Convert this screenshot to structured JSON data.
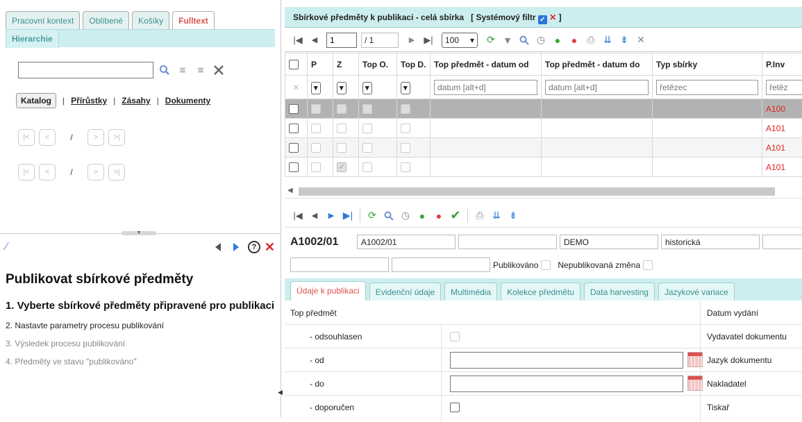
{
  "left": {
    "tabs": [
      "Pracovní kontext",
      "Oblíbené",
      "Košíky",
      "Fulltext"
    ],
    "tab_hierarchy": "Hierarchie",
    "search": {
      "value": ""
    },
    "links": {
      "katalog": "Katalog",
      "prirustky": "Přírůstky",
      "zasahy": "Zásahy",
      "dokumenty": "Dokumenty",
      "sep": "|"
    },
    "pager": {
      "first": "|<",
      "prev": "<",
      "slash": "/",
      "next": ">",
      "last": ">|"
    },
    "wizard": {
      "title": "Publikovat sbírkové předměty",
      "step1": "1. Vyberte sbírkové předměty připravené pro publikaci",
      "step2": "2. Nastavte parametry procesu publikování",
      "step3": "3. Výsledek procesu publikování",
      "step4": "4. Předměty ve stavu \"publikováno\"",
      "help": "?",
      "close": "✕"
    }
  },
  "right": {
    "title": "Sbírkové předměty k publikaci - celá sbírka",
    "filter_prefix": "[ Systémový filtr",
    "filter_suffix": "]",
    "pager": {
      "page": "1",
      "total": "/ 1",
      "size": "100"
    },
    "grid": {
      "columns": [
        "P",
        "Z",
        "Top O.",
        "Top D.",
        "Top předmět - datum od",
        "Top předmět - datum do",
        "Typ sbírky",
        "P.Inv"
      ],
      "filters": {
        "date_from": "datum [alt+d]",
        "date_to": "datum [alt+d]",
        "typ": "řetězec",
        "pinv": "řetěz"
      },
      "rows": [
        {
          "pinv": "A100"
        },
        {
          "pinv": "A101"
        },
        {
          "pinv": "A101"
        },
        {
          "pinv": "A101"
        }
      ]
    },
    "detail": {
      "record_id": "A1002/01",
      "field1": "A1002/01",
      "field2": "",
      "field3": "DEMO",
      "field4": "historická",
      "publikovano": "Publikováno",
      "nepublikovana": "Nepublikovaná změna"
    },
    "detail_tabs": [
      "Údaje k publikaci",
      "Evidenční údaje",
      "Multimédia",
      "Kolekce předmětu",
      "Data harvesting",
      "Jazykové variace"
    ],
    "form": {
      "top_predmet": "Top předmět",
      "odsouhlasen": "- odsouhlasen",
      "od": "- od",
      "do": "- do",
      "doporucen": "- doporučen",
      "datum_vydani": "Datum vydání",
      "vydavatel": "Vydavatel dokumentu",
      "jazyk": "Jazyk dokumentu",
      "nakladatel": "Nakladatel",
      "tiskar": "Tiskař"
    }
  },
  "colors": {
    "teal": "#cdeeee",
    "accent_red": "#d9534f",
    "inv_red": "#e12020",
    "blue": "#2f74d8"
  }
}
